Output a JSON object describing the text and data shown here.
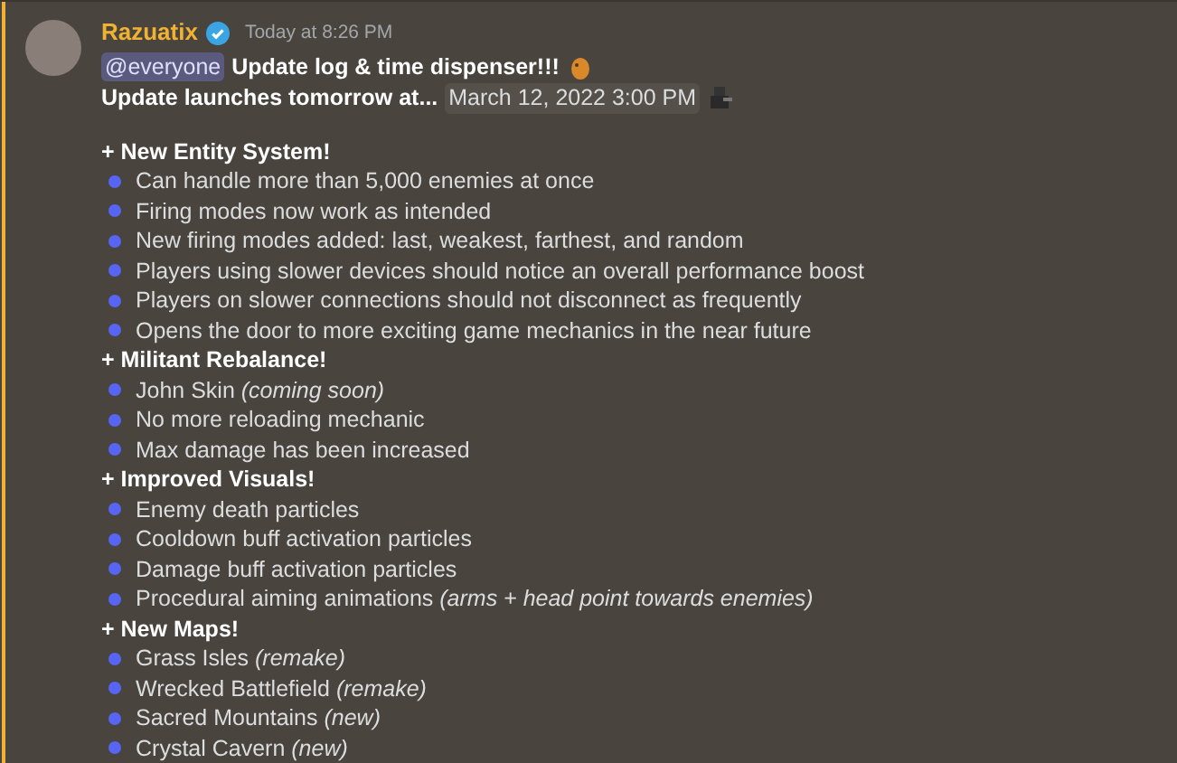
{
  "message": {
    "author": "Razuatix",
    "verified": true,
    "timestamp": "Today at 8:26 PM",
    "mention": "@everyone",
    "title": "Update log & time dispenser!!!",
    "launch_text": "Update launches tomorrow at...",
    "launch_time": "March 12, 2022 3:00 PM"
  },
  "sections": [
    {
      "heading": "+ New Entity System!",
      "items": [
        "Can handle more than 5,000 enemies at once",
        "Firing modes now work as intended",
        "New firing modes added: last, weakest, farthest, and random",
        "Players using slower devices should notice an overall performance boost",
        "Players on slower connections should not disconnect as frequently",
        "Opens the door to more exciting game mechanics in the near future"
      ]
    },
    {
      "heading": "+ Militant Rebalance!",
      "items": [
        "John Skin *(coming soon)*",
        "No more reloading mechanic",
        "Max damage has been increased"
      ]
    },
    {
      "heading": "+ Improved Visuals!",
      "items": [
        "Enemy death particles",
        "Cooldown buff activation particles",
        "Damage buff activation particles",
        "Procedural aiming animations *(arms + head point towards enemies)*"
      ]
    },
    {
      "heading": "+ New Maps!",
      "items": [
        "Grass Isles *(remake)*",
        "Wrecked Battlefield *(remake)*",
        "Sacred Mountains *(new)*",
        "Crystal Cavern *(new)*"
      ]
    }
  ]
}
